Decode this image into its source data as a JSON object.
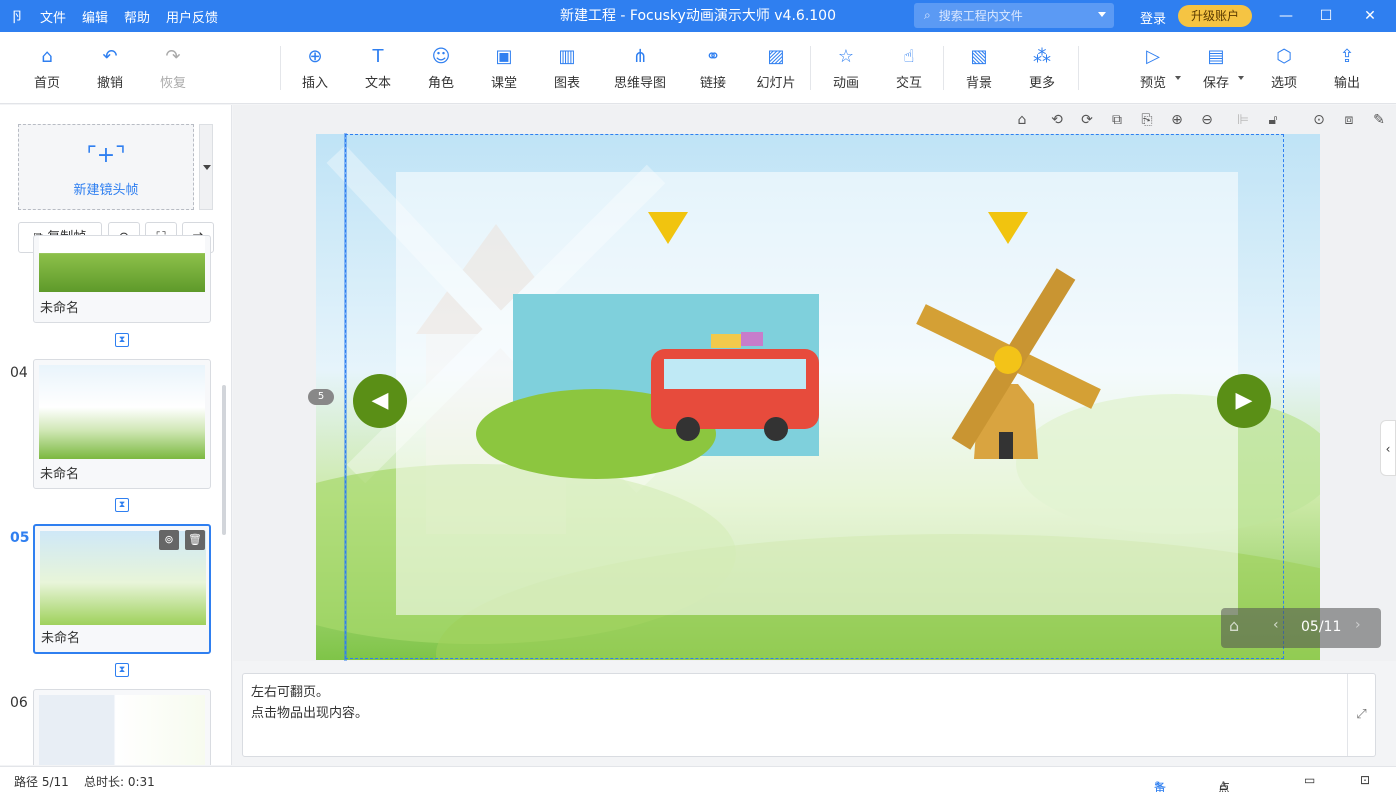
{
  "titlebar": {
    "logo": "卪",
    "menu": [
      "文件",
      "编辑",
      "帮助",
      "用户反馈"
    ],
    "window_title": "新建工程 - Focusky动画演示大师  v4.6.100",
    "search_placeholder": "搜索工程内文件",
    "login": "登录",
    "upgrade": "升级账户"
  },
  "toolbar": {
    "items": [
      {
        "label": "首页",
        "icon": "home-icon"
      },
      {
        "label": "撤销",
        "icon": "undo-icon"
      },
      {
        "label": "恢复",
        "icon": "redo-icon"
      },
      {
        "label": "插入",
        "icon": "plus-circle-icon"
      },
      {
        "label": "文本",
        "icon": "text-icon"
      },
      {
        "label": "角色",
        "icon": "character-icon"
      },
      {
        "label": "课堂",
        "icon": "classroom-icon"
      },
      {
        "label": "图表",
        "icon": "chart-icon"
      },
      {
        "label": "思维导图",
        "icon": "mindmap-icon"
      },
      {
        "label": "链接",
        "icon": "link-icon"
      },
      {
        "label": "幻灯片",
        "icon": "slides-icon"
      },
      {
        "label": "动画",
        "icon": "star-icon"
      },
      {
        "label": "交互",
        "icon": "hand-icon"
      },
      {
        "label": "背景",
        "icon": "background-icon"
      },
      {
        "label": "更多",
        "icon": "more-icon"
      },
      {
        "label": "预览",
        "icon": "preview-icon"
      },
      {
        "label": "保存",
        "icon": "save-icon"
      },
      {
        "label": "选项",
        "icon": "options-icon"
      },
      {
        "label": "输出",
        "icon": "export-icon"
      }
    ]
  },
  "sidebar": {
    "new_frame": "新建镜头帧",
    "copy_frame": "复制帧",
    "frames": [
      {
        "num": "",
        "label": "未命名"
      },
      {
        "num": "04",
        "label": "未命名"
      },
      {
        "num": "05",
        "label": "未命名"
      },
      {
        "num": "06",
        "label": ""
      }
    ]
  },
  "canvas": {
    "frame_badge": "5",
    "page_info": "05/11",
    "prev_arrow": "◀",
    "next_arrow": "▶"
  },
  "notes": {
    "line1": "左右可翻页。",
    "line2": "点击物品出现内容。"
  },
  "status": {
    "path": "路径 5/11",
    "duration": "总时长: 0:31",
    "notes_tab": "备注",
    "rollcall": "点名"
  },
  "colors": {
    "accent": "#2f7ff0",
    "upgrade": "#f5c443",
    "nav_green": "#5a8f16"
  }
}
